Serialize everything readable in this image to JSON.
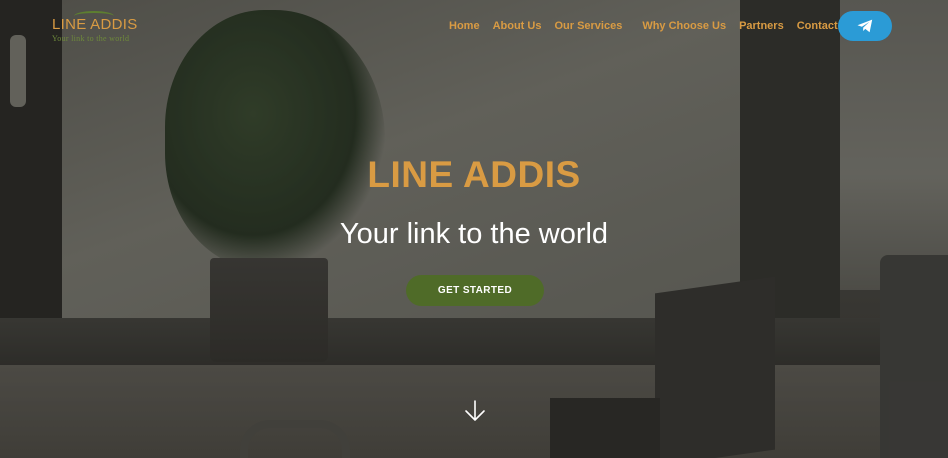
{
  "brand": {
    "name": "LINE ADDIS",
    "tagline": "Your link to the world"
  },
  "nav": {
    "items": [
      {
        "label": "Home"
      },
      {
        "label": "About Us"
      },
      {
        "label": "Our Services"
      },
      {
        "label": "Why Choose Us"
      },
      {
        "label": "Partners"
      },
      {
        "label": "Contact Us"
      }
    ],
    "telegram_icon": "telegram-send-icon"
  },
  "hero": {
    "title": "LINE ADDIS",
    "subtitle": "Your link to the world",
    "cta_label": "GET STARTED",
    "scroll_icon": "arrow-down-icon"
  },
  "colors": {
    "accent": "#d99b43",
    "cta": "#4f6b28",
    "telegram": "#2b9bd6"
  }
}
